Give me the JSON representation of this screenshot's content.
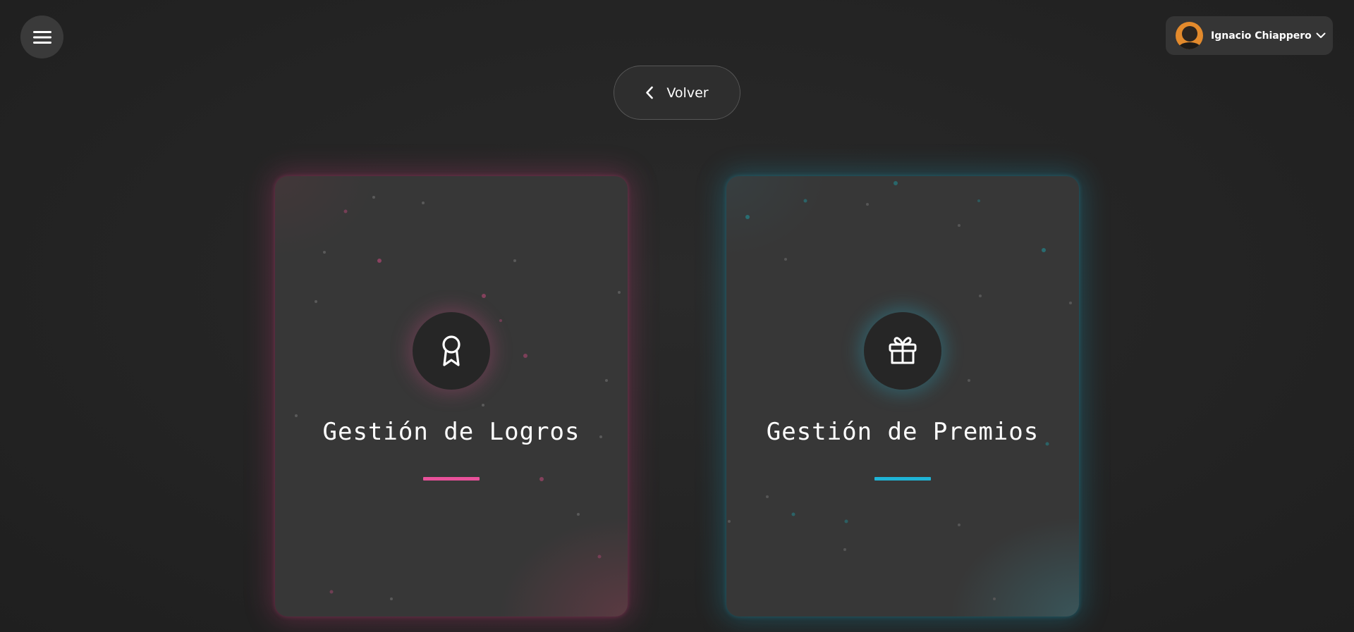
{
  "header": {
    "menu_icon": "hamburger-icon",
    "user": {
      "name": "Ignacio Chiappero",
      "avatar": "user-avatar",
      "dropdown_icon": "chevron-down-icon"
    }
  },
  "back_button": {
    "label": "Volver",
    "icon": "chevron-left-icon"
  },
  "cards": [
    {
      "title": "Gestión de Logros",
      "icon": "award-ribbon-icon",
      "accent_color": "#e8519a"
    },
    {
      "title": "Gestión de Premios",
      "icon": "gift-icon",
      "accent_color": "#1fb4d6"
    }
  ],
  "colors": {
    "background": "#232323",
    "card": "#373737",
    "pink_accent": "#e8519a",
    "cyan_accent": "#1fb4d6"
  }
}
